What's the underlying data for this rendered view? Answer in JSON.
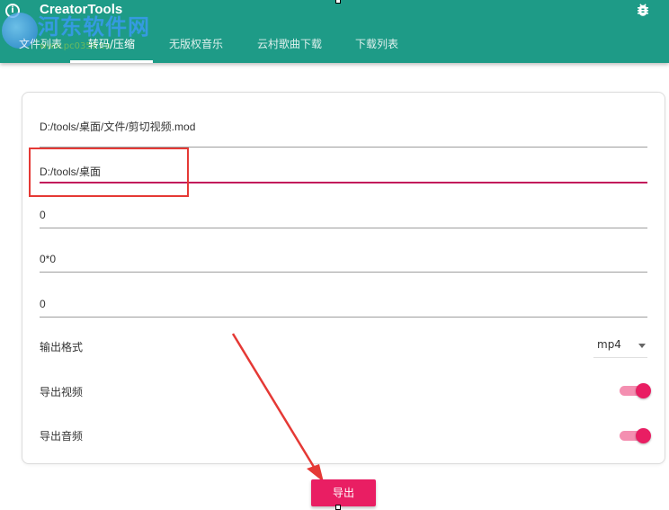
{
  "app": {
    "title": "CreatorTools",
    "info_glyph": "i"
  },
  "watermark": {
    "text": "河东软件网",
    "url": "www.pc0359.cn"
  },
  "tabs": [
    {
      "label": "文件列表",
      "active": false
    },
    {
      "label": "转码/压缩",
      "active": true
    },
    {
      "label": "无版权音乐",
      "active": false
    },
    {
      "label": "云村歌曲下载",
      "active": false
    },
    {
      "label": "下载列表",
      "active": false
    }
  ],
  "form": {
    "input_path": "D:/tools/桌面/文件/剪切视频.mod",
    "output_path": "D:/tools/桌面",
    "field3": "0",
    "resolution": "0*0",
    "field5": "0",
    "format_label": "输出格式",
    "format_value": "mp4",
    "export_video_label": "导出视频",
    "export_video_on": true,
    "export_audio_label": "导出音频",
    "export_audio_on": true,
    "export_button": "导出"
  },
  "colors": {
    "appbar": "#1e9b87",
    "accent": "#e91e63",
    "focus_underline": "#c2185b",
    "annotation": "#e53935"
  },
  "icons": {
    "app": "info-icon",
    "settings": "bug-icon",
    "dropdown": "caret-down-icon"
  }
}
